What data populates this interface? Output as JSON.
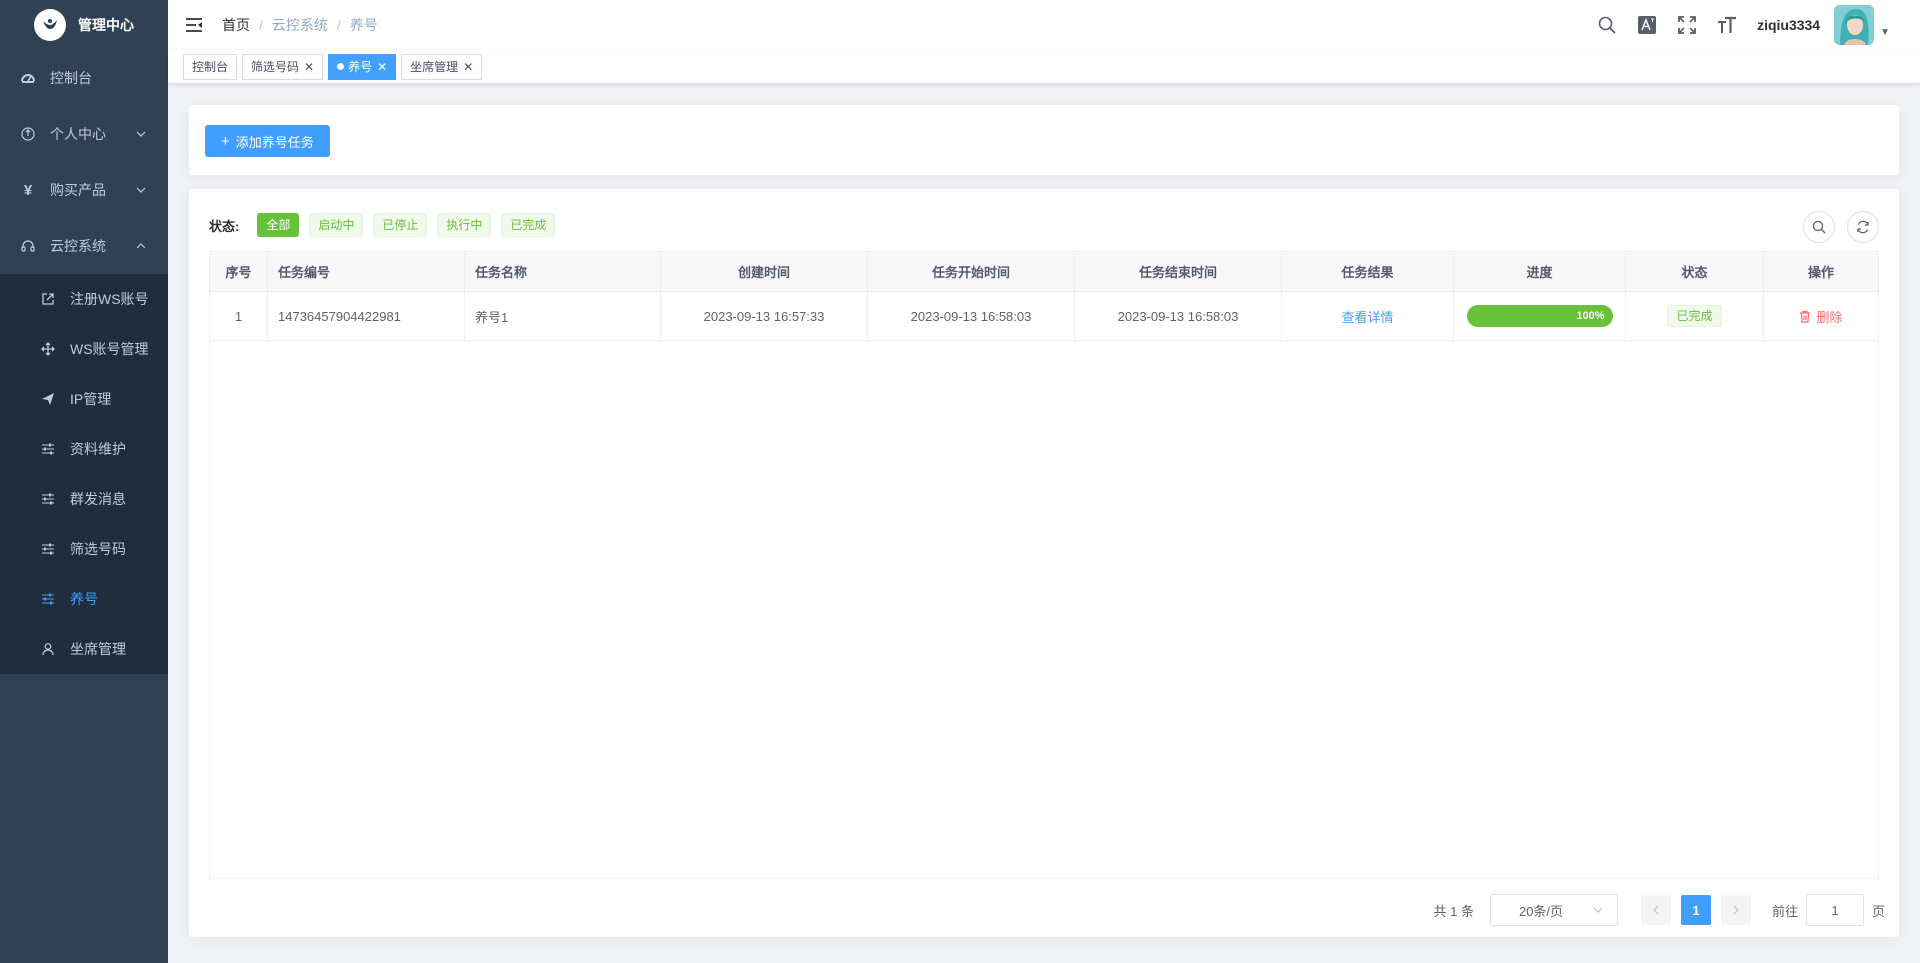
{
  "app": {
    "title": "管理中心"
  },
  "sidebar": {
    "items": [
      {
        "label": "控制台",
        "icon": "dashboard-icon"
      },
      {
        "label": "个人中心",
        "icon": "user-circle-icon",
        "expandable": true
      },
      {
        "label": "购买产品",
        "icon": "yen-icon",
        "expandable": true
      },
      {
        "label": "云控系统",
        "icon": "headset-icon",
        "expandable": true,
        "expanded": true
      }
    ],
    "submenu": [
      {
        "label": "注册WS账号",
        "icon": "external-link-icon"
      },
      {
        "label": "WS账号管理",
        "icon": "move-icon"
      },
      {
        "label": "IP管理",
        "icon": "send-icon"
      },
      {
        "label": "资料维护",
        "icon": "sliders-icon"
      },
      {
        "label": "群发消息",
        "icon": "sliders-icon"
      },
      {
        "label": "筛选号码",
        "icon": "sliders-icon"
      },
      {
        "label": "养号",
        "icon": "sliders-icon",
        "active": true
      },
      {
        "label": "坐席管理",
        "icon": "user-icon"
      }
    ]
  },
  "header": {
    "breadcrumb": [
      "首页",
      "云控系统",
      "养号"
    ],
    "username": "ziqiu3334"
  },
  "tags": [
    {
      "label": "控制台",
      "closable": false
    },
    {
      "label": "筛选号码",
      "closable": true
    },
    {
      "label": "养号",
      "closable": true,
      "active": true
    },
    {
      "label": "坐席管理",
      "closable": true
    }
  ],
  "toolbar": {
    "add_label": "添加养号任务"
  },
  "filter": {
    "label": "状态:",
    "options": [
      "全部",
      "启动中",
      "已停止",
      "执行中",
      "已完成"
    ],
    "active_index": 0
  },
  "table": {
    "columns": [
      "序号",
      "任务编号",
      "任务名称",
      "创建时间",
      "任务开始时间",
      "任务结束时间",
      "任务结果",
      "进度",
      "状态",
      "操作"
    ],
    "rows": [
      {
        "index": "1",
        "task_no": "14736457904422981",
        "task_name": "养号1",
        "created": "2023-09-13 16:57:33",
        "start": "2023-09-13 16:58:03",
        "end": "2023-09-13 16:58:03",
        "result_link": "查看详情",
        "progress": 100,
        "progress_label": "100%",
        "status": "已完成",
        "action": "删除"
      }
    ]
  },
  "pagination": {
    "total": "共 1 条",
    "page_size": "20条/页",
    "current": "1",
    "jump_prefix": "前往",
    "jump_value": "1",
    "jump_suffix": "页"
  },
  "colors": {
    "sidebar_bg": "#304156",
    "submenu_bg": "#1f2d3d",
    "primary": "#409eff",
    "success": "#67c23a",
    "danger": "#f56c6c"
  }
}
